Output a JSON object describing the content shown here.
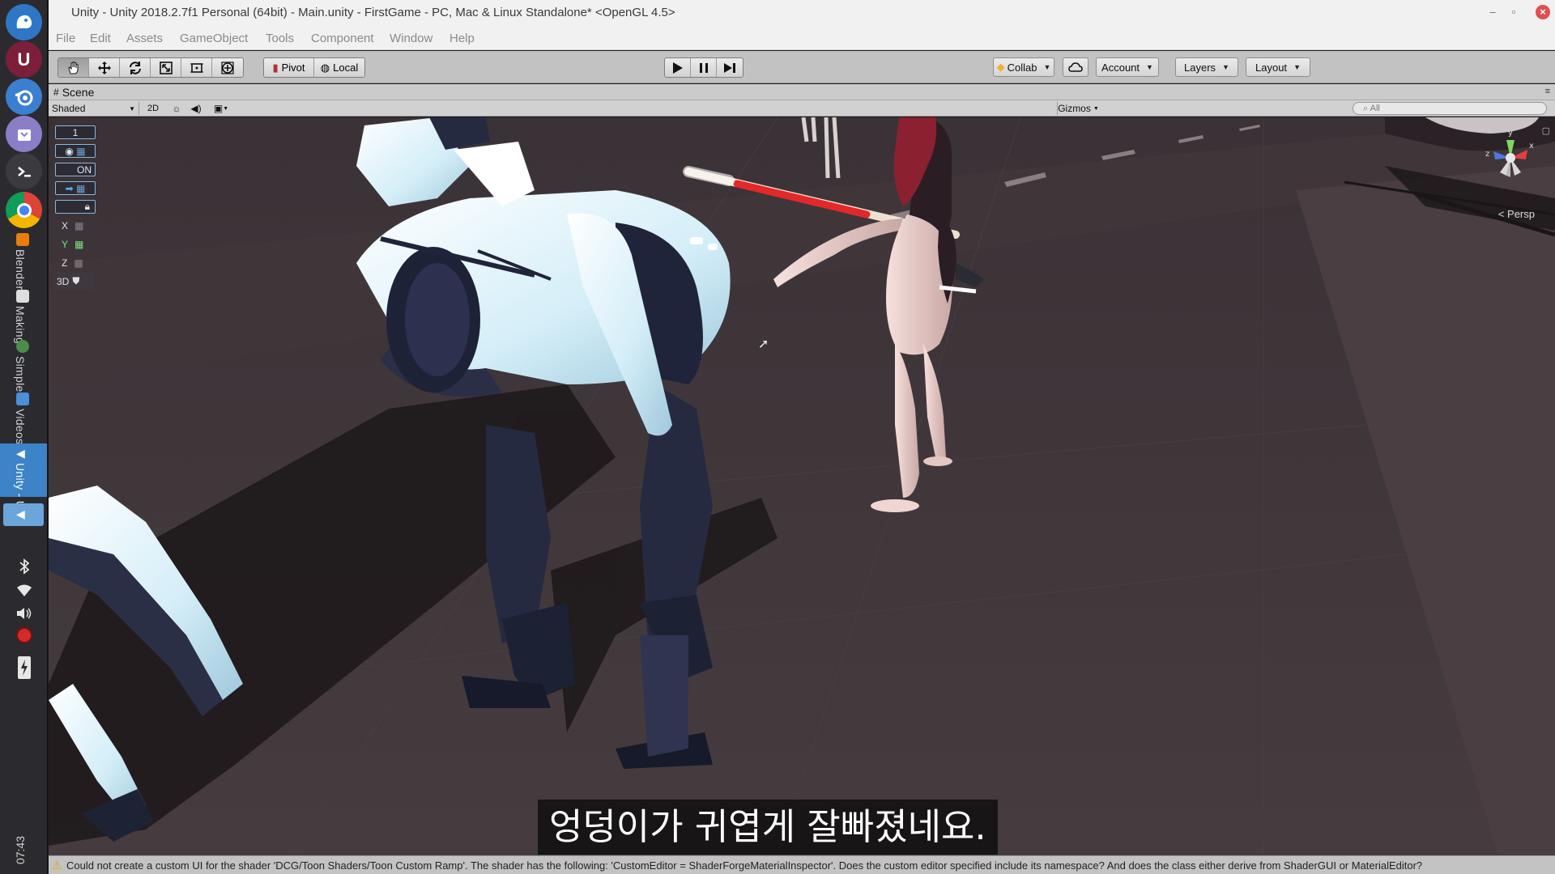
{
  "window": {
    "title": "Unity - Unity 2018.2.7f1 Personal (64bit) - Main.unity - FirstGame - PC, Mac & Linux Standalone* <OpenGL 4.5>"
  },
  "menu": [
    "File",
    "Edit",
    "Assets",
    "GameObject",
    "Tools",
    "Component",
    "Window",
    "Help"
  ],
  "toolbar": {
    "pivot_label": "Pivot",
    "local_label": "Local",
    "collab_label": "Collab",
    "account_label": "Account",
    "layers_label": "Layers",
    "layout_label": "Layout"
  },
  "scene": {
    "tab_label": "Scene",
    "shading_mode": "Shaded",
    "mode_2d": "2D",
    "gizmos_label": "Gizmos",
    "search_placeholder": "All",
    "persp_label": "Persp",
    "overlay": {
      "layer_number": "1",
      "on_label": "ON",
      "axis_x": "X",
      "axis_y": "Y",
      "axis_z": "Z",
      "mode_3d": "3D"
    },
    "gizmo_axes": {
      "y": "y",
      "z": "z",
      "x": "x"
    }
  },
  "subtitle": "엉덩이가 귀엽게 잘빠졌네요.",
  "status": {
    "message": "Could not create a custom UI for the shader 'DCG/Toon Shaders/Toon Custom Ramp'. The shader has the following: 'CustomEditor = ShaderForgeMaterialInspector'. Does the custom editor specified include its namespace? And does the class either derive from ShaderGUI or MaterialEditor?"
  },
  "dock": {
    "labels": [
      "Blender",
      "Making",
      "Simple",
      "Videos",
      "Unity - U"
    ],
    "clock": "07:43"
  },
  "colors": {
    "accent": "#3c83c8",
    "robot_body": "#dff1f8",
    "robot_dark": "#262a40",
    "road": "#3a3034",
    "warning": "#e0a800"
  }
}
